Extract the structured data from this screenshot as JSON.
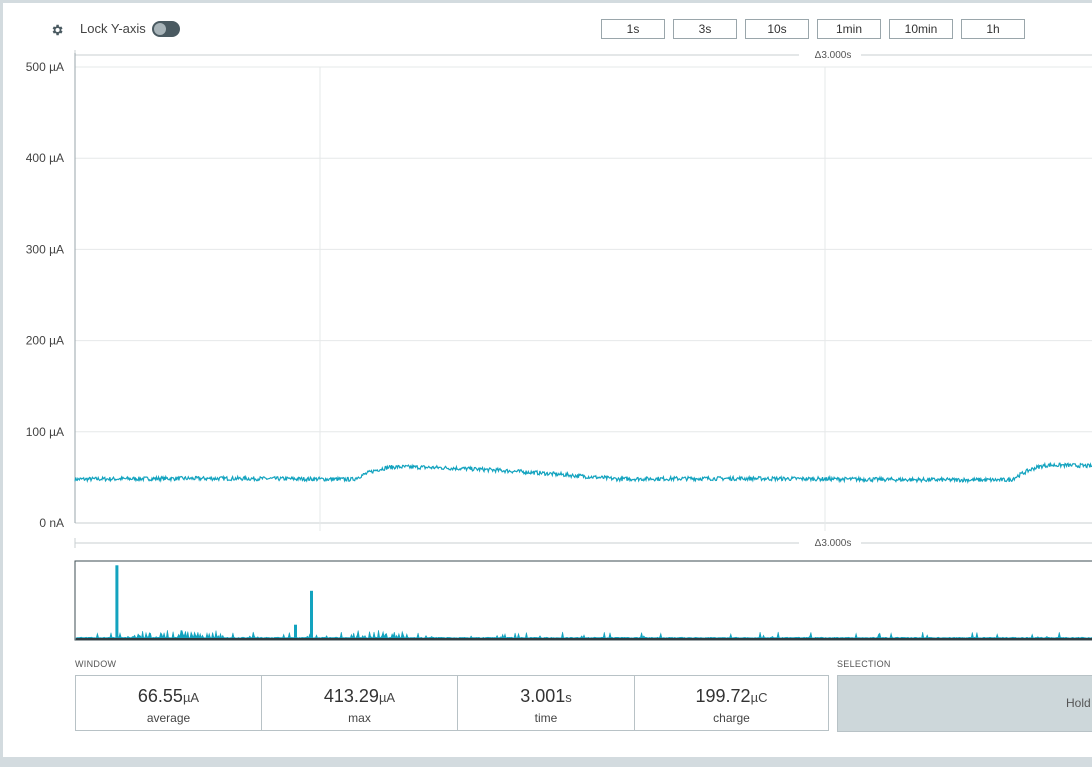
{
  "toolbar": {
    "gear_icon": "gear-icon",
    "lock_label": "Lock Y-axis",
    "lock_on": false,
    "window_buttons": [
      "1s",
      "3s",
      "10s",
      "1min",
      "10min",
      "1h"
    ]
  },
  "colors": {
    "trace": "#13a3bf",
    "grid": "#e6e8e9",
    "axis": "#9aa6ab",
    "toggle": "#4a5a61"
  },
  "chart_data": [
    {
      "type": "line",
      "series": [
        {
          "values": []
        }
      ],
      "y_unit": "µA",
      "ylim": [
        0,
        500
      ],
      "y_ticks": [
        "0 nA",
        "100 µA",
        "200 µA",
        "300 µA",
        "400 µA",
        "500 µA"
      ],
      "y_tick_values": [
        0,
        100,
        200,
        300,
        400,
        500
      ],
      "time_span_label": "Δ3.000s",
      "time_span_s": 3.0,
      "grid": true,
      "baseline_uA": 48,
      "bumps": [
        {
          "start_s": 0.82,
          "peak_s": 0.95,
          "end_s": 1.6,
          "peak_uA": 62
        },
        {
          "start_s": 2.76,
          "peak_s": 2.88,
          "end_s": 3.3,
          "peak_uA": 64
        }
      ]
    },
    {
      "type": "area",
      "description_key": "overview",
      "x_range_s": [
        0,
        3.3
      ],
      "ylim": [
        0,
        420
      ],
      "spikes": [
        {
          "t_s": 0.133,
          "value_uA": 413
        },
        {
          "t_s": 0.765,
          "value_uA": 270
        },
        {
          "t_s": 0.713,
          "value_uA": 80
        }
      ],
      "noise_level_uA": 20
    }
  ],
  "window": {
    "label": "WINDOW",
    "stats": [
      {
        "value": "66.55",
        "unit": "µA",
        "label": "average"
      },
      {
        "value": "413.29",
        "unit": "µA",
        "label": "max"
      },
      {
        "value": "3.001",
        "unit": "s",
        "label": "time"
      },
      {
        "value": "199.72",
        "unit": "µC",
        "label": "charge"
      }
    ]
  },
  "selection": {
    "label": "SELECTION",
    "hint": "Hold"
  }
}
